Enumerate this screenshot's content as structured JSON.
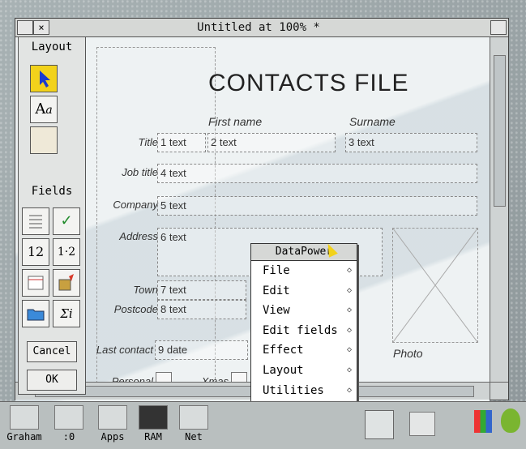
{
  "window": {
    "title": "Untitled at 100% *",
    "close_glyph": "×"
  },
  "toolbox": {
    "title": "Layout",
    "fields_title": "Fields",
    "cancel_label": "Cancel",
    "ok_label": "OK",
    "tools": {
      "text_tool_glyph": "A",
      "text_tool_sub": "a",
      "check_glyph": "✓",
      "integer_glyph": "12",
      "decimal_glyph": "1·2",
      "sum_glyph": "Σi"
    }
  },
  "form": {
    "heading": "CONTACTS FILE",
    "hint_first": "First name",
    "hint_surname": "Surname",
    "labels": {
      "title": "Title",
      "job_title": "Job title",
      "company": "Company",
      "address": "Address",
      "town": "Town",
      "postcode": "Postcode",
      "last_contact": "Last contact",
      "personal": "Personal",
      "xmas": "Xmas",
      "photo": "Photo"
    },
    "fields": {
      "f1": "1 text",
      "f2": "2 text",
      "f3": "3 text",
      "f4": "4 text",
      "f5": "5 text",
      "f6": "6 text",
      "f7": "7 text",
      "f8": "8 text",
      "f9": "9 date"
    }
  },
  "menu": {
    "title": "DataPower",
    "items": [
      "File",
      "Edit",
      "View",
      "Edit fields",
      "Effect",
      "Layout",
      "Utilities"
    ],
    "arrow": "◇"
  },
  "iconbar": {
    "items": [
      "Graham",
      ":0",
      "Apps",
      "RAM",
      "Net"
    ]
  }
}
